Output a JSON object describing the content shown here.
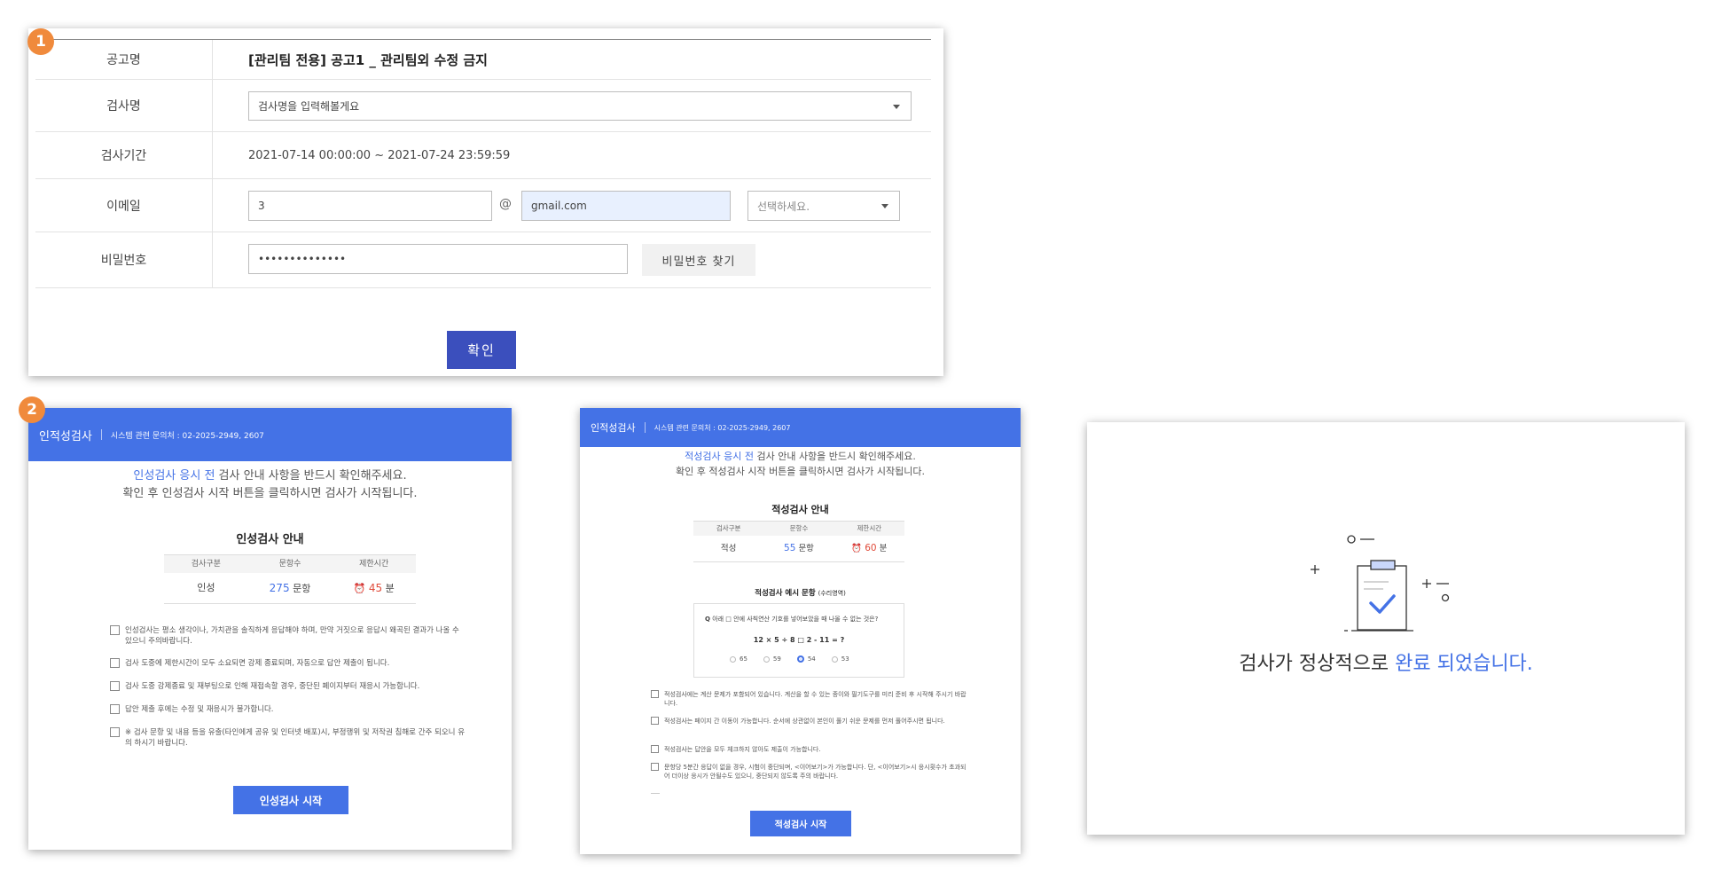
{
  "badges": {
    "step1": "1",
    "step2": "2"
  },
  "login_form": {
    "rows": {
      "notice_label": "공고명",
      "notice_value": "[관리팀 전용] 공고1 _ 관리팀외 수정 금지",
      "test_label": "검사명",
      "test_placeholder": "검사명을 입력해볼게요",
      "period_label": "검사기간",
      "period_value": "2021-07-14 00:00:00 ~ 2021-07-24 23:59:59",
      "email_label": "이메일",
      "email_id_value": "3",
      "email_at": "@",
      "email_domain_value": "gmail.com",
      "email_select_placeholder": "선택하세요.",
      "password_label": "비밀번호",
      "password_value": "••••••••••••••",
      "find_password_label": "비밀번호 찾기"
    },
    "confirm_label": "확인"
  },
  "personality": {
    "brand": "인적성검사",
    "contact": "시스템 관련 문의처 : 02-2025-2949, 2607",
    "notice_highlight": "인성검사 응시 전",
    "notice_line1_rest": " 검사 안내 사항을 반드시 확인해주세요.",
    "notice_line2": "확인 후 인성검사 시작 버튼을 클릭하시면 검사가 시작됩니다.",
    "guide_title": "인성검사 안내",
    "table_headers": [
      "검사구분",
      "문항수",
      "제한시간"
    ],
    "table_row": {
      "type": "인성",
      "count": "275",
      "count_unit": " 문항",
      "time": "45",
      "time_unit": " 분"
    },
    "checklist": [
      "인성검사는 평소 생각이나, 가치관을 솔직하게 응답해야 하며, 만약 거짓으로 응답시 왜곡된 결과가 나올 수 있으니 주의바랍니다.",
      "검사 도중에 제한시간이 모두 소요되면 강제 종료되며, 자동으로 답안 제출이 됩니다.",
      "검사 도중 강제종료 및 재부팅으로 인해 재접속할 경우, 중단된 페이지부터 재응시 가능합니다.",
      "답안 제출 후에는 수정 및 재응시가 불가합니다.",
      "※ 검사 문항 및 내용 등을 유출(타인에게 공유 및 인터넷 배포)시, 부정행위 및 저작권 침해로 간주 되오니 유의 하시기 바랍니다."
    ],
    "start_label": "인성검사 시작"
  },
  "aptitude": {
    "brand": "인적성검사",
    "contact": "시스템 관련 문의처 : 02-2025-2949, 2607",
    "notice_highlight": "적성검사 응시 전",
    "notice_line1_rest": " 검사 안내 사항을 반드시 확인해주세요.",
    "notice_line2": "확인 후 적성검사 시작 버튼을 클릭하시면 검사가 시작됩니다.",
    "guide_title": "적성검사 안내",
    "table_headers": [
      "검사구분",
      "문항수",
      "제한시간"
    ],
    "table_row": {
      "type": "적성",
      "count": "55",
      "count_unit": " 문항",
      "time": "60",
      "time_unit": " 분"
    },
    "example_title": "적성검사 예시 문항",
    "example_sub": "(수리영역)",
    "question_prefix": "Q",
    "question": "아래 □ 안에 사칙연산 기호를 넣어보았을 때 나올 수 없는 것은?",
    "expression": "12 × 5 ÷ 8 □ 2 - 11 = ?",
    "options": [
      "65",
      "59",
      "54",
      "53"
    ],
    "selected_option": "54",
    "checklist": [
      "적성검사에는 계산 문제가 포함되어 있습니다. 계산을 할 수 있는 종이와 필기도구를 미리 준비 후 시작해 주시기 바랍니다.",
      "적성검사는 페이지 간 이동이 가능합니다. 순서에 상관없이 본인이 풀기 쉬운 문제를 먼저 풀어주시면 됩니다.",
      "적성검사는 답안을 모두 체크하지 않아도 제출이 가능합니다.",
      "문항당 5분간 응답이 없을 경우, 시험이 중단되며, <이어보기>가 가능합니다. 단, <이어보기>시 응시횟수가 초과되어 더이상 응시가 안될수도 있으니, 중단되지 않도록 주의 바랍니다."
    ],
    "start_label": "적성검사 시작"
  },
  "complete": {
    "message_prefix": "검사가 정상적으로 ",
    "message_highlight": "완료 되었습니다.",
    "icon": "clipboard-check-icon",
    "accent": "#4472e6"
  },
  "colors": {
    "primary": "#4472e6",
    "confirm": "#3b4fbd",
    "badge": "#f08a3c",
    "time_red": "#e04b3a"
  }
}
